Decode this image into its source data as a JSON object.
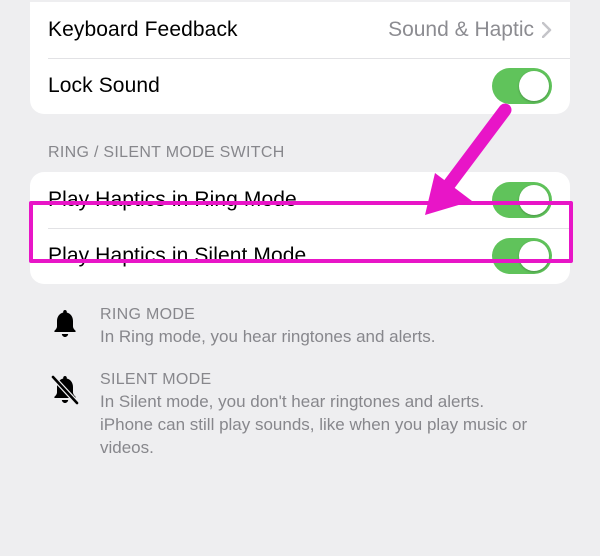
{
  "group1": {
    "keyboard_feedback": {
      "label": "Keyboard Feedback",
      "value": "Sound & Haptic"
    },
    "lock_sound": {
      "label": "Lock Sound",
      "on": true
    }
  },
  "section2_header": "RING / SILENT MODE SWITCH",
  "group2": {
    "ring_haptics": {
      "label": "Play Haptics in Ring Mode",
      "on": true
    },
    "silent_haptics": {
      "label": "Play Haptics in Silent Mode",
      "on": true
    }
  },
  "info": {
    "ring": {
      "title": "RING MODE",
      "body": "In Ring mode, you hear ringtones and alerts."
    },
    "silent": {
      "title": "SILENT MODE",
      "body": "In Silent mode, you don't hear ringtones and alerts. iPhone can still play sounds, like when you play music or videos."
    }
  },
  "annotation": {
    "color": "#e815c7"
  }
}
